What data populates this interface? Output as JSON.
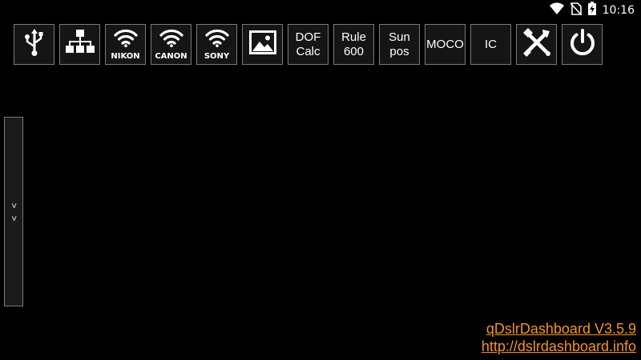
{
  "status_bar": {
    "time": "10:16",
    "icons": [
      "wifi-icon",
      "no-sim-icon",
      "battery-charging-icon"
    ]
  },
  "toolbar": {
    "buttons": [
      {
        "id": "usb",
        "icon": "usb-icon"
      },
      {
        "id": "network",
        "icon": "network-icon"
      },
      {
        "id": "nikon",
        "icon": "wifi-icon",
        "label": "NIKON"
      },
      {
        "id": "canon",
        "icon": "wifi-icon",
        "label": "CANON"
      },
      {
        "id": "sony",
        "icon": "wifi-icon",
        "label": "SONY"
      },
      {
        "id": "gallery",
        "icon": "image-icon"
      },
      {
        "id": "dof",
        "label": "DOF\nCalc"
      },
      {
        "id": "rule600",
        "label": "Rule\n600"
      },
      {
        "id": "sunpos",
        "label": "Sun\npos"
      },
      {
        "id": "moco",
        "label": "MOCO"
      },
      {
        "id": "ic",
        "label": "IC"
      },
      {
        "id": "tools",
        "icon": "tools-icon"
      },
      {
        "id": "power",
        "icon": "power-icon"
      }
    ]
  },
  "side_panel": {
    "handle_text": [
      ">",
      ">"
    ]
  },
  "footer": {
    "version": "qDslrDashboard V3.5.9",
    "url": "http://dslrdashboard.info"
  },
  "colors": {
    "background": "#000000",
    "button_bg": "#151515",
    "button_border": "#7a7a7a",
    "footer_link": "#f7931e"
  }
}
